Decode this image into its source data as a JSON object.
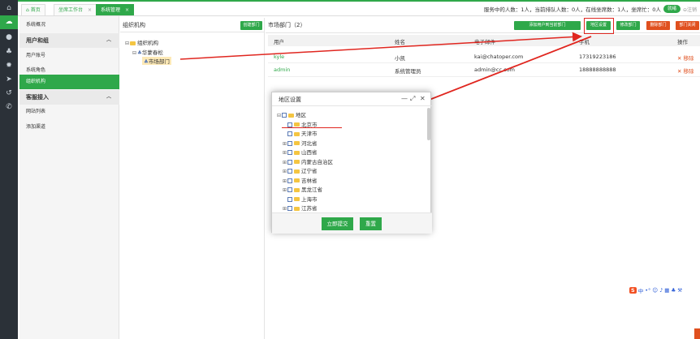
{
  "topbar": {
    "tabs": [
      {
        "label": "首页"
      },
      {
        "label": "坐席工作台"
      },
      {
        "label": "系统管理"
      }
    ],
    "status_text": "服务中的人数：1人，当前排队人数：0人，在线坐席数：1人，坐席忙：0人",
    "status_toggle": "就绪",
    "logout_label": "注销"
  },
  "rail": {
    "icons": [
      "home-icon",
      "cloud-icon",
      "user-icon",
      "group-icon",
      "gear-icon",
      "send-icon",
      "history-icon",
      "phone-icon"
    ]
  },
  "sidebar": {
    "items": [
      {
        "type": "item",
        "label": "系统概况"
      },
      {
        "type": "group",
        "label": "用户和组"
      },
      {
        "type": "item",
        "label": "用户账号"
      },
      {
        "type": "item",
        "label": "系统角色"
      },
      {
        "type": "item",
        "label": "组织机构",
        "active": true
      },
      {
        "type": "group",
        "label": "客服接入"
      },
      {
        "type": "item",
        "label": "网站列表"
      },
      {
        "type": "item",
        "label": "添加渠道"
      }
    ]
  },
  "org": {
    "title": "组织机构",
    "create_btn": "创建部门",
    "tree": [
      {
        "label": "组织机构",
        "level": 0
      },
      {
        "label": "华蒙春松",
        "level": 1
      },
      {
        "label": "市场部门",
        "level": 2,
        "selected": true
      }
    ]
  },
  "dept": {
    "title": "市场部门（2）",
    "buttons": {
      "add_user": "添加用户到当前部门",
      "region_set": "地区设置",
      "edit": "修改部门",
      "delete": "删除部门",
      "closed": "部门关闭"
    },
    "columns": [
      "用户",
      "姓名",
      "电子邮件",
      "手机",
      "操作"
    ],
    "rows": [
      {
        "user": "kyle",
        "name": "小凯",
        "email": "kai@chatoper.com",
        "phone": "17319223186",
        "action": "移除"
      },
      {
        "user": "admin",
        "name": "系统管理员",
        "email": "admin@cc.com",
        "phone": "18888888888",
        "action": "移除"
      }
    ]
  },
  "modal": {
    "title": "地区设置",
    "tree": [
      {
        "label": "地区",
        "level": 0,
        "expander": "⊟"
      },
      {
        "label": "北京市",
        "level": 1,
        "expander": ""
      },
      {
        "label": "天津市",
        "level": 1,
        "expander": ""
      },
      {
        "label": "河北省",
        "level": 1,
        "expander": "⊞"
      },
      {
        "label": "山西省",
        "level": 1,
        "expander": "⊞"
      },
      {
        "label": "内蒙古自治区",
        "level": 1,
        "expander": "⊞"
      },
      {
        "label": "辽宁省",
        "level": 1,
        "expander": "⊞"
      },
      {
        "label": "吉林省",
        "level": 1,
        "expander": "⊞"
      },
      {
        "label": "黑龙江省",
        "level": 1,
        "expander": "⊞"
      },
      {
        "label": "上海市",
        "level": 1,
        "expander": ""
      },
      {
        "label": "江苏省",
        "level": 1,
        "expander": "⊞"
      }
    ],
    "submit": "立即提交",
    "reset": "重置"
  },
  "ime": {
    "logo": "S",
    "label": "中"
  },
  "colors": {
    "accent": "#2fa84a",
    "danger": "#e0501f",
    "rail": "#2b3138",
    "annotation": "#e0261f"
  }
}
